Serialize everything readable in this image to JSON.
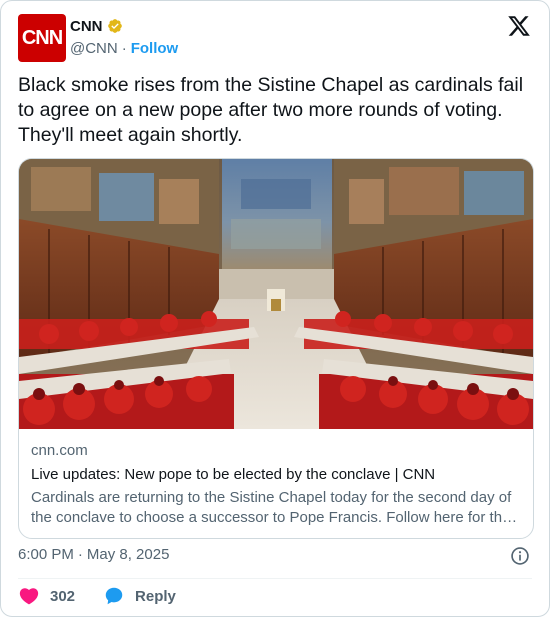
{
  "author": {
    "display_name": "CNN",
    "handle": "@CNN",
    "separator": "·",
    "follow_label": "Follow",
    "avatar_text": "CNN",
    "brand_color": "#cc0000",
    "verified": "gold"
  },
  "tweet": {
    "text": "Black smoke rises from the Sistine Chapel as cardinals fail to agree on a new pope after two more rounds of voting. They'll meet again shortly."
  },
  "link_card": {
    "domain": "cnn.com",
    "title": "Live updates: New pope to be elected by the conclave | CNN",
    "description": "Cardinals are returning to the Sistine Chapel today for the second day of the conclave to choose a successor to Pope Francis. Follow here for th…",
    "image": "sistine-chapel-conclave-photo"
  },
  "footer": {
    "time": "6:00 PM",
    "separator": "·",
    "date": "May 8, 2025"
  },
  "actions": {
    "like_count": "302",
    "reply_label": "Reply"
  },
  "colors": {
    "accent": "#1d9bf0",
    "like": "#f91880",
    "muted": "#536471"
  }
}
